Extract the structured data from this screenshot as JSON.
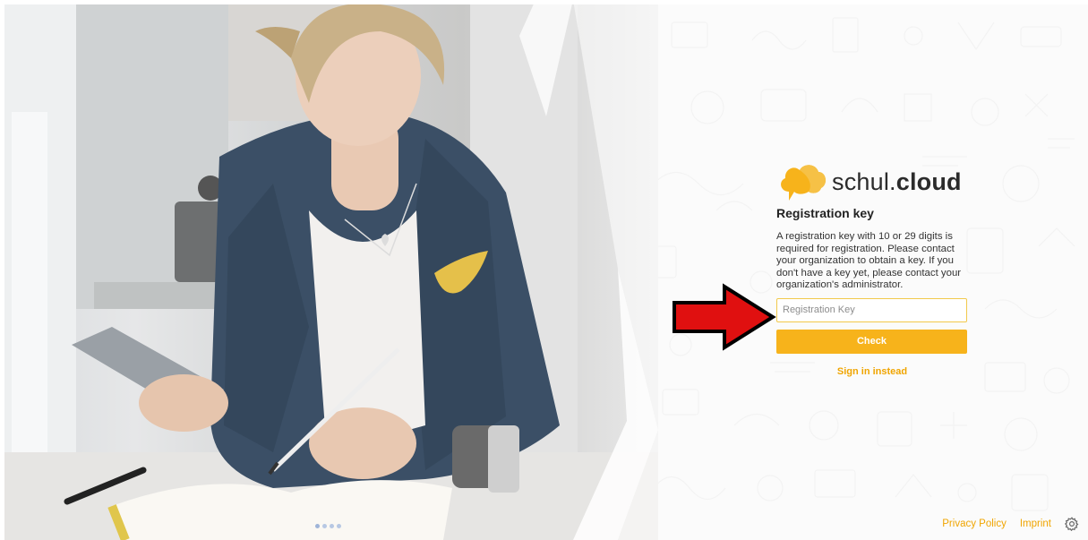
{
  "logo": {
    "text_regular": "schul.",
    "text_bold": "cloud",
    "icon": "speech-cloud-icon",
    "brand_color": "#f7b31b"
  },
  "registration": {
    "title": "Registration key",
    "description": "A registration key with 10 or 29 digits is required for registration. Please contact your organization to obtain a key. If you don't have a key yet, please contact your organization's administrator.",
    "input_placeholder": "Registration Key",
    "input_value": "",
    "check_label": "Check",
    "signin_label": "Sign in instead"
  },
  "carousel": {
    "slide_count": 4,
    "active_index": 0
  },
  "footer": {
    "privacy_label": "Privacy Policy",
    "imprint_label": "Imprint",
    "settings_icon": "gear-icon"
  },
  "annotation": {
    "arrow_color": "#e01010",
    "arrow_outline": "#000000"
  },
  "colors": {
    "accent": "#f7b31b",
    "link": "#f0a500",
    "input_border": "#f2c94c"
  }
}
